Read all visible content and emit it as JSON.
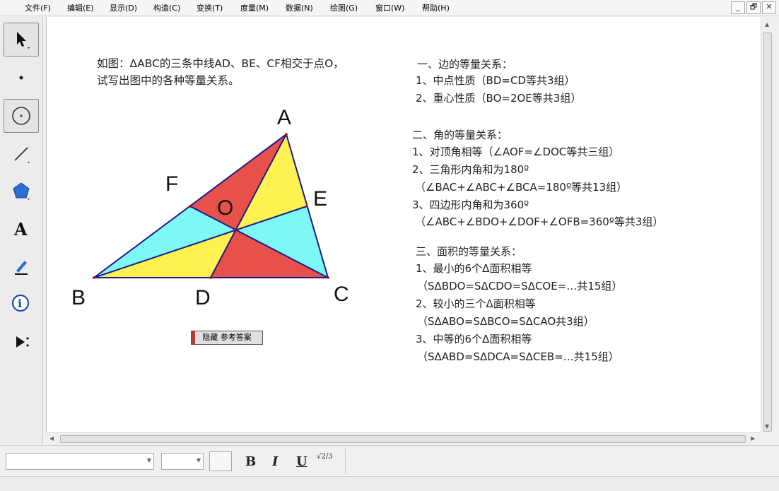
{
  "menu": [
    "文件(F)",
    "编辑(E)",
    "显示(D)",
    "构造(C)",
    "变换(T)",
    "度量(M)",
    "数据(N)",
    "绘图(G)",
    "窗口(W)",
    "帮助(H)"
  ],
  "window_buttons": [
    "_",
    "🗗",
    "✕"
  ],
  "problem_text": "如图：ΔABC的三条中线AD、BE、CF相交于点O，试写出图中的各种等量关系。",
  "points": {
    "A": "A",
    "B": "B",
    "C": "C",
    "D": "D",
    "E": "E",
    "F": "F",
    "O": "O"
  },
  "hide_button_label": "隐藏 参考答案",
  "answers": [
    "一、边的等量关系：",
    "1、中点性质（BD=CD等共3组）",
    "2、重心性质（BO=2OE等共3组）",
    "二、角的等量关系：",
    "1、对顶角相等（∠AOF=∠DOC等共三组）",
    "2、三角形内角和为180º",
    "（∠BAC+∠ABC+∠BCA=180º等共13组）",
    "3、四边形内角和为360º",
    "（∠ABC+∠BDO+∠DOF+∠OFB=360º等共3组）",
    "三、面积的等量关系：",
    "1、最小的6个Δ面积相等",
    "（SΔBDO=SΔCDO=SΔCOE=…共15组）",
    "2、较小的三个Δ面积相等",
    "（SΔABO=SΔBCO=SΔCAO共3组）",
    "3、中等的6个Δ面积相等",
    "（SΔABD=SΔDCA=SΔCEB=…共15组）"
  ],
  "format": {
    "bold": "B",
    "italic": "I",
    "underline": "U",
    "math": "√2/3"
  },
  "colors": {
    "red": "#e8504a",
    "yellow": "#fdf24f",
    "cyan": "#7ef7f7",
    "edge": "#1a1a8c"
  }
}
